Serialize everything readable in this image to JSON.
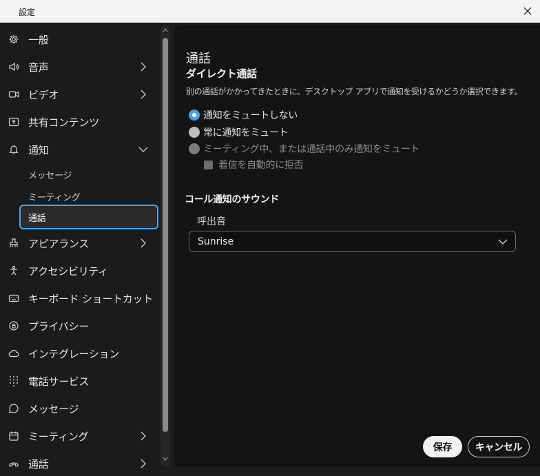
{
  "window": {
    "title": "設定"
  },
  "sidebar": {
    "items": [
      {
        "label": "一般",
        "icon": "gear-icon",
        "has_submenu": false
      },
      {
        "label": "音声",
        "icon": "speaker-icon",
        "has_submenu": true
      },
      {
        "label": "ビデオ",
        "icon": "video-icon",
        "has_submenu": true
      },
      {
        "label": "共有コンテンツ",
        "icon": "share-screen-icon",
        "has_submenu": false
      },
      {
        "label": "通知",
        "icon": "bell-icon",
        "has_submenu": true,
        "expanded": true
      },
      {
        "label": "アピアランス",
        "icon": "appearance-icon",
        "has_submenu": true
      },
      {
        "label": "アクセシビリティ",
        "icon": "accessibility-icon",
        "has_submenu": false
      },
      {
        "label": "キーボード ショートカット",
        "icon": "keyboard-icon",
        "has_submenu": false
      },
      {
        "label": "プライバシー",
        "icon": "privacy-icon",
        "has_submenu": false
      },
      {
        "label": "インテグレーション",
        "icon": "cloud-icon",
        "has_submenu": false
      },
      {
        "label": "電話サービス",
        "icon": "dialpad-icon",
        "has_submenu": false
      },
      {
        "label": "メッセージ",
        "icon": "chat-icon",
        "has_submenu": false
      },
      {
        "label": "ミーティング",
        "icon": "calendar-icon",
        "has_submenu": true
      },
      {
        "label": "通話",
        "icon": "phone-icon",
        "has_submenu": true
      }
    ],
    "notification_subitems": [
      {
        "label": "メッセージ",
        "active": false
      },
      {
        "label": "ミーティング",
        "active": false
      },
      {
        "label": "通話",
        "active": true
      }
    ]
  },
  "main": {
    "title": "通話",
    "section_title": "ダイレクト通話",
    "description": "別の通話がかかってきたときに、デスクトップ アプリで通知を受けるかどうか選択できます。",
    "radio_options": [
      {
        "label": "通知をミュートしない",
        "selected": true,
        "disabled": false
      },
      {
        "label": "常に通知をミュート",
        "selected": false,
        "disabled": false
      },
      {
        "label": "ミーティング中、または通話中のみ通知をミュート",
        "selected": false,
        "disabled": true
      }
    ],
    "checkbox": {
      "label": "着信を自動的に拒否",
      "checked": false,
      "disabled": true
    },
    "sound_section_title": "コール通知のサウンド",
    "ringtone_label": "呼出音",
    "ringtone_value": "Sunrise"
  },
  "footer": {
    "save_label": "保存",
    "cancel_label": "キャンセル"
  },
  "colors": {
    "accent": "#4aa3e8",
    "background": "#141414",
    "sidebar": "#1b1b1b",
    "titlebar": "#f3f3f3"
  }
}
